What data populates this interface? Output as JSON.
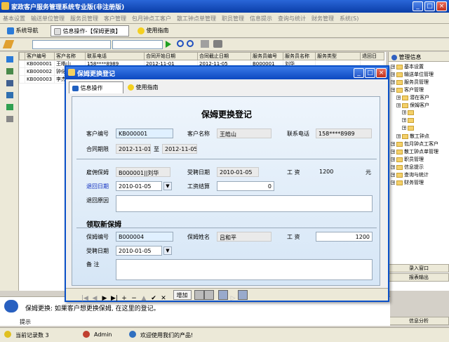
{
  "app": {
    "title": "家政客户服务管理系统专业版(非注册版)"
  },
  "menu": [
    "基本设置",
    "输送单位管理",
    "服务员管理",
    "客户管理",
    "包月钟点工客户",
    "散工钟点单管理",
    "职员管理",
    "信息提示",
    "查询与统计",
    "财务管理",
    "系统(S)"
  ],
  "tabs": {
    "nav": "系统导航",
    "info": "信息操作-【保姆更换】",
    "help": "使用指南"
  },
  "grid": {
    "headers": [
      "客户编号",
      "客户名称",
      "联系电话",
      "合同开始日期",
      "合同截止日期",
      "服务员编号",
      "服务员名称",
      "服务类型",
      "退回日"
    ],
    "rows": [
      [
        "KB000001",
        "王皓山",
        "158****8989",
        "2012-11-01",
        "2012-11-05",
        "B000001",
        "刘华",
        "",
        ""
      ],
      [
        "KB000002",
        "钟化",
        "",
        "",
        "",
        "",
        "",
        "",
        ""
      ],
      [
        "KB000003",
        "李杰",
        "",
        "",
        "",
        "",
        "",
        "",
        ""
      ]
    ]
  },
  "tree": {
    "header": "管理信息",
    "items": [
      "基本设置",
      "输送单位管理",
      "服务员管理",
      "客户管理",
      "潜在客户",
      "保姆客户",
      "",
      "",
      "",
      "散工钟点",
      "包月钟点工客户",
      "散工钟点单管理",
      "职员管理",
      "信息提示",
      "查询与统计",
      "财务管理"
    ]
  },
  "rightbtns": [
    "录入窗口",
    "报表输出",
    "信息分析"
  ],
  "hint": {
    "text": "保姆更换: 如果客户想更换保姆, 在这里的登记。",
    "label": "提示"
  },
  "status": {
    "count": "当前记录数 3",
    "user": "Admin",
    "welcome": "欢迎使用我们的产品!"
  },
  "dialog": {
    "title": "保姆更换登记",
    "tab_info": "信息操作",
    "tab_help": "使用指南",
    "form_title": "保姆更换登记",
    "cust_no_lbl": "客户编号",
    "cust_no": "KB000001",
    "cust_name_lbl": "客户名称",
    "cust_name": "王皓山",
    "phone_lbl": "联系电话",
    "phone": "158****8989",
    "period_lbl": "合同期限",
    "period_from": "2012-11-01",
    "period_to_lbl": "至",
    "period_to": "2012-11-05",
    "hired_lbl": "雇佣保姆",
    "hired": "B000001||刘华",
    "hire_date_lbl": "受聘日期",
    "hire_date": "2010-01-05",
    "wage_lbl": "工  资",
    "wage": "1200",
    "yuan": "元",
    "return_date_lbl": "退回日期",
    "return_date": "2010-01-05",
    "settle_lbl": "工资结算",
    "settle": "0",
    "reason_lbl": "退回原因",
    "new_section": "领取新保姆",
    "new_no_lbl": "保姆编号",
    "new_no": "B000004",
    "new_name_lbl": "保姆姓名",
    "new_name": "吕和平",
    "new_wage_lbl": "工  资",
    "new_wage": "1200",
    "new_hire_date_lbl": "受聘日期",
    "new_hire_date": "2010-01-05",
    "remark_lbl": "备  注",
    "add_btn": "增加"
  }
}
